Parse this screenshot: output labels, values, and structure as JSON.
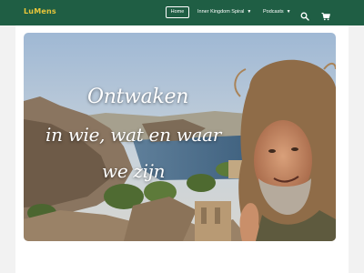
{
  "header": {
    "logo": "LuMens",
    "nav": {
      "home": "Home",
      "inner_kingdom": "Inner Kingdom Spiral",
      "podcasts": "Podcasts"
    },
    "icons": {
      "search": "search-icon",
      "cart": "cart-icon",
      "dropdown": "chevron-down-icon"
    },
    "colors": {
      "bar": "#1f5e44",
      "logo": "#e8c63a"
    }
  },
  "hero": {
    "line1": "Ontwaken",
    "line2": "in wie, wat en waar",
    "line3": "we zijn"
  }
}
